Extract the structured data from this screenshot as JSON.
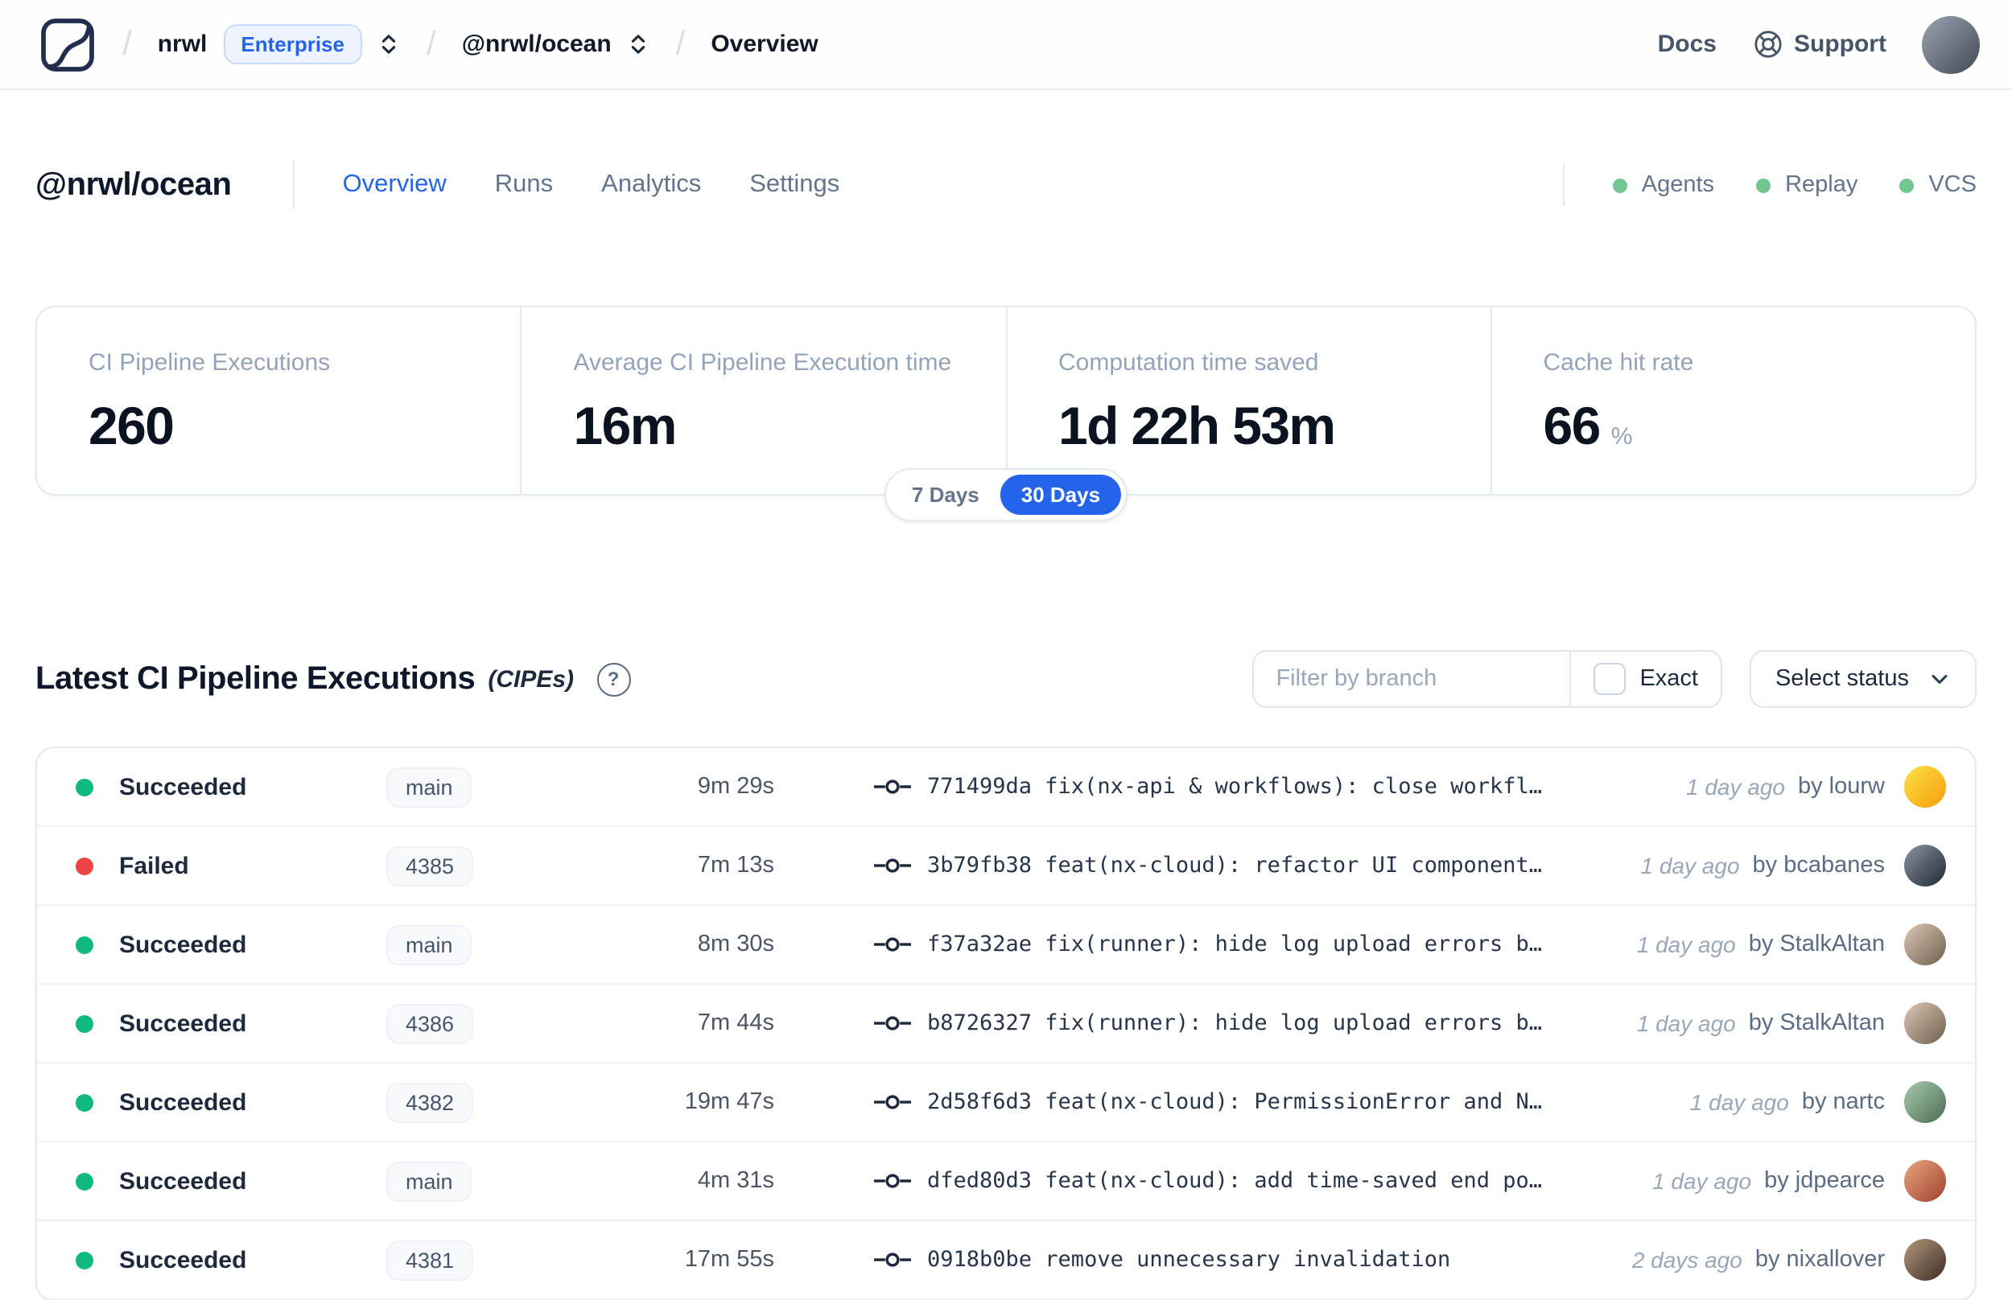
{
  "topnav": {
    "org": "nrwl",
    "plan_badge": "Enterprise",
    "workspace": "@nrwl/ocean",
    "page": "Overview",
    "links": {
      "docs": "Docs",
      "support": "Support"
    },
    "avatar": [
      "#9aa5b1",
      "#3f4a56"
    ]
  },
  "header": {
    "workspace": "@nrwl/ocean",
    "tabs": [
      {
        "label": "Overview",
        "active": true
      },
      {
        "label": "Runs",
        "active": false
      },
      {
        "label": "Analytics",
        "active": false
      },
      {
        "label": "Settings",
        "active": false
      }
    ],
    "legend": {
      "dot_color": "#72c691",
      "items": [
        "Agents",
        "Replay",
        "VCS"
      ]
    }
  },
  "stats": [
    {
      "label": "CI Pipeline Executions",
      "value": "260",
      "suffix": ""
    },
    {
      "label": "Average CI Pipeline Execution time",
      "value": "16m",
      "suffix": ""
    },
    {
      "label": "Computation time saved",
      "value": "1d 22h 53m",
      "suffix": ""
    },
    {
      "label": "Cache hit rate",
      "value": "66",
      "suffix": "%"
    }
  ],
  "range_toggle": {
    "options": [
      "7 Days",
      "30 Days"
    ],
    "selected": "30 Days",
    "active_color": "#2563eb"
  },
  "cipes": {
    "title": "Latest CI Pipeline Executions",
    "title_note": "(CIPEs)",
    "filter_placeholder": "Filter by branch",
    "exact_label": "Exact",
    "status_button": "Select status",
    "rows": [
      {
        "status": "Succeeded",
        "dot_color": "#10b981",
        "branch": "main",
        "duration": "9m 29s",
        "commit": "771499da fix(nx-api & workflows): close workfl…",
        "time": "1 day ago",
        "author": "by lourw",
        "avatar": [
          "#fde047",
          "#f59e0b"
        ]
      },
      {
        "status": "Failed",
        "dot_color": "#ef4444",
        "branch": "4385",
        "duration": "7m 13s",
        "commit": "3b79fb38 feat(nx-cloud): refactor UI component…",
        "time": "1 day ago",
        "author": "by bcabanes",
        "avatar": [
          "#8b95a1",
          "#1f2937"
        ]
      },
      {
        "status": "Succeeded",
        "dot_color": "#10b981",
        "branch": "main",
        "duration": "8m 30s",
        "commit": "f37a32ae fix(runner): hide log upload errors b…",
        "time": "1 day ago",
        "author": "by StalkAltan",
        "avatar": [
          "#dcc9b4",
          "#6e5d4f"
        ]
      },
      {
        "status": "Succeeded",
        "dot_color": "#10b981",
        "branch": "4386",
        "duration": "7m 44s",
        "commit": "b8726327 fix(runner): hide log upload errors b…",
        "time": "1 day ago",
        "author": "by StalkAltan",
        "avatar": [
          "#dcc9b4",
          "#6e5d4f"
        ]
      },
      {
        "status": "Succeeded",
        "dot_color": "#10b981",
        "branch": "4382",
        "duration": "19m 47s",
        "commit": "2d58f6d3 feat(nx-cloud): PermissionError and N…",
        "time": "1 day ago",
        "author": "by nartc",
        "avatar": [
          "#a8cbae",
          "#4b6b53"
        ]
      },
      {
        "status": "Succeeded",
        "dot_color": "#10b981",
        "branch": "main",
        "duration": "4m 31s",
        "commit": "dfed80d3 feat(nx-cloud): add time-saved end po…",
        "time": "1 day ago",
        "author": "by jdpearce",
        "avatar": [
          "#e8a87c",
          "#a04030"
        ]
      },
      {
        "status": "Succeeded",
        "dot_color": "#10b981",
        "branch": "4381",
        "duration": "17m 55s",
        "commit": "0918b0be remove unnecessary invalidation",
        "time": "2 days ago",
        "author": "by nixallover",
        "avatar": [
          "#b3977e",
          "#3d2e24"
        ]
      }
    ]
  }
}
